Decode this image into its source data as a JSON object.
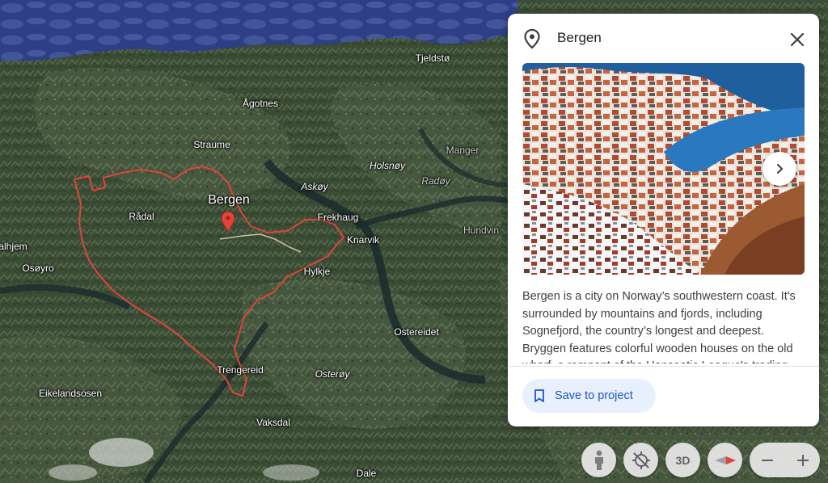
{
  "map": {
    "places": [
      {
        "name": "Tjeldstø",
        "style": "normal"
      },
      {
        "name": "Ågotnes",
        "style": "normal"
      },
      {
        "name": "Straume",
        "style": "normal"
      },
      {
        "name": "Manger",
        "style": "faded"
      },
      {
        "name": "Holsnøy",
        "style": "italic"
      },
      {
        "name": "Askøy",
        "style": "italic"
      },
      {
        "name": "Radøy",
        "style": "italic faded"
      },
      {
        "name": "Bergen",
        "style": "city"
      },
      {
        "name": "Rådal",
        "style": "normal"
      },
      {
        "name": "Frekhaug",
        "style": "normal"
      },
      {
        "name": "Knarvik",
        "style": "normal"
      },
      {
        "name": "Hundvin",
        "style": "faded"
      },
      {
        "name": "alhjem",
        "style": "normal"
      },
      {
        "name": "Osøyro",
        "style": "normal"
      },
      {
        "name": "Hylkje",
        "style": "normal"
      },
      {
        "name": "Ostereidet",
        "style": "normal"
      },
      {
        "name": "Trengereid",
        "style": "normal"
      },
      {
        "name": "Osterøy",
        "style": "italic"
      },
      {
        "name": "Eikelandsosen",
        "style": "normal"
      },
      {
        "name": "Vaksdal",
        "style": "normal"
      },
      {
        "name": "Dale",
        "style": "normal"
      }
    ],
    "boundary_color": "#e0443a"
  },
  "card": {
    "title": "Bergen",
    "description": "Bergen is a city on Norway’s southwestern coast. It's surrounded by mountains and fjords, including Sognefjord, the country’s longest and deepest. Bryggen features colorful wooden houses on the old wharf, a remnant of the Hanseatic League's trading empire.",
    "save_label": "Save to project",
    "accent": "#1a57c6"
  },
  "controls": {
    "view_3d_label": "3D"
  }
}
